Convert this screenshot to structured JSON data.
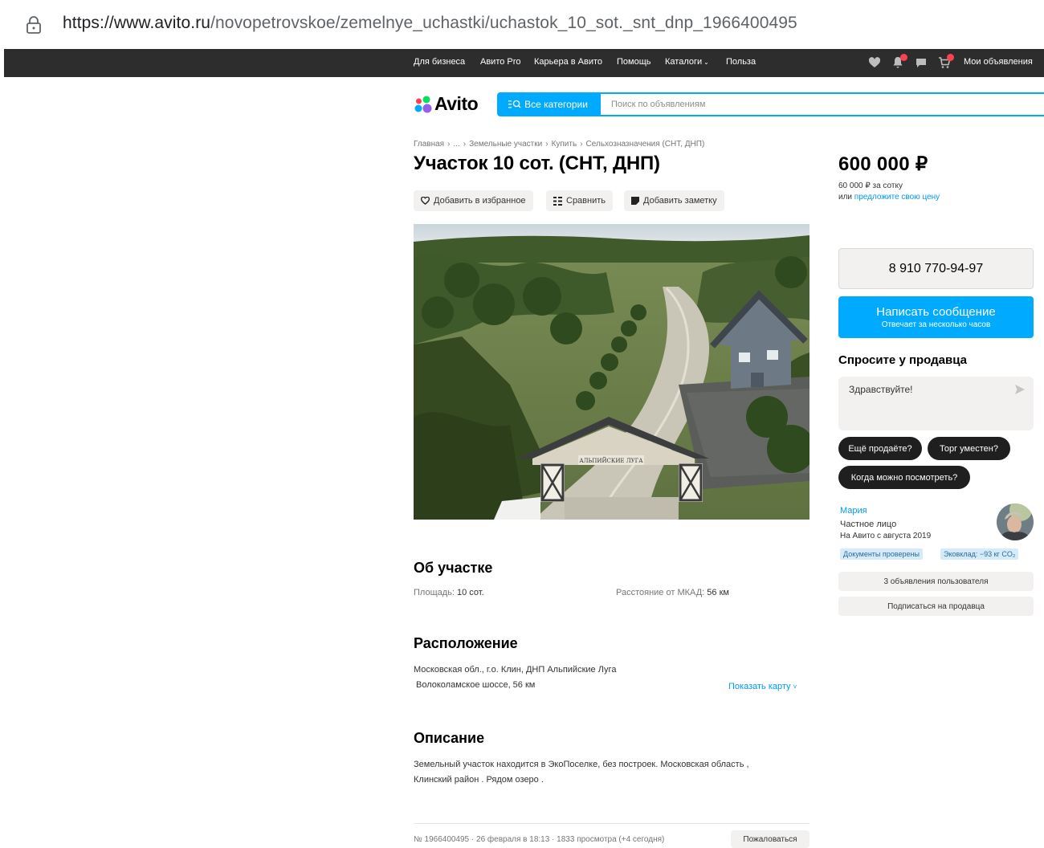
{
  "browser": {
    "url_host": "https://www.avito.ru",
    "url_path": "/novopetrovskoe/zemelnye_uchastki/uchastok_10_sot._snt_dnp_1966400495"
  },
  "topnav": {
    "links": [
      "Для бизнеса",
      "Авито Pro",
      "Карьера в Авито",
      "Помощь",
      "Каталоги",
      "Польза"
    ],
    "my_ads": "Мои объявления"
  },
  "header": {
    "logo": "Avito",
    "categories_label": "Все категории",
    "search_placeholder": "Поиск по объявлениям"
  },
  "breadcrumb": [
    "Главная",
    "...",
    "Земельные участки",
    "Купить",
    "Сельхозназначения (СНТ, ДНП)"
  ],
  "listing": {
    "title": "Участок 10 сот. (СНТ, ДНП)",
    "actions": {
      "favorite": "Добавить в избранное",
      "compare": "Сравнить",
      "note": "Добавить заметку"
    },
    "photo_sign": "АЛЬПИЙСКИЕ ЛУГА",
    "about": {
      "heading": "Об участке",
      "area_label": "Площадь:",
      "area_value": "10 сот.",
      "distance_label": "Расстояние от МКАД:",
      "distance_value": "56 км"
    },
    "location": {
      "heading": "Расположение",
      "address": "Московская обл., г.о. Клин, ДНП Альпийские Луга",
      "road": "Волоколамское шоссе, 56 км",
      "map_link": "Показать карту"
    },
    "description": {
      "heading": "Описание",
      "line1": "Земельный участок находится в ЭкоПоселке, без построек. Московская область ,",
      "line2": "Клинский район . Рядом озеро ."
    },
    "meta": "№ 1966400495 · 26 февраля в 18:13 · 1833 просмотра (+4 сегодня)",
    "report": "Пожаловаться"
  },
  "sidebar": {
    "price": "600 000 ₽",
    "per_sotka": "60 000 ₽ за сотку",
    "offer_prefix": "или",
    "offer_link": "предложите свою цену",
    "phone": "8 910 770-94-97",
    "message_button": "Написать сообщение",
    "message_sub": "Отвечает за несколько часов",
    "ask_title": "Спросите у продавца",
    "ask_text": "Здравствуйте!",
    "chips": [
      "Ещё продаёте?",
      "Торг уместен?",
      "Когда можно посмотреть?"
    ],
    "seller": {
      "name": "Мария",
      "type": "Частное лицо",
      "since": "На Авито с августа 2019",
      "tags": [
        "Документы проверены",
        "Эковклад: −93 кг CO₂"
      ]
    },
    "seller_ads": "3 объявления пользователя",
    "subscribe": "Подписаться на продавца"
  },
  "colors": {
    "accent": "#00aaff",
    "link": "#0099f7",
    "topbar": "#2d2d2d",
    "badge": "#ff4053"
  }
}
